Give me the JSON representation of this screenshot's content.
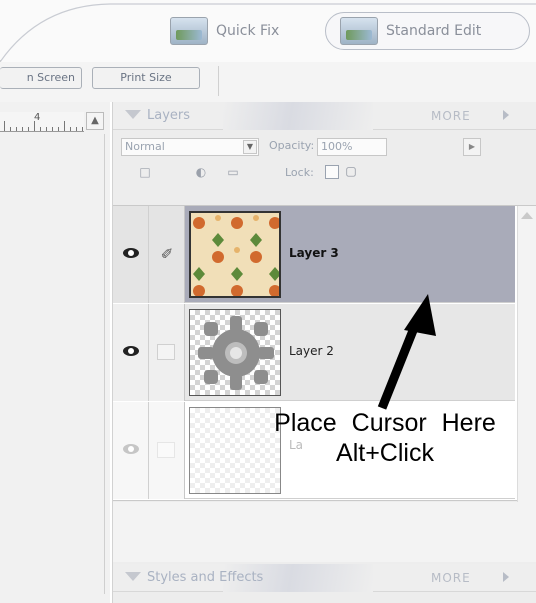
{
  "mode_bar": {
    "quick_fix_label": "Quick Fix",
    "standard_edit_label": "Standard Edit"
  },
  "zoom_bar": {
    "fit_screen_label": "n Screen",
    "print_size_label": "Print Size"
  },
  "ruler": {
    "number": "4"
  },
  "layers_panel": {
    "title": "Layers",
    "more_label": "MORE",
    "blend_mode": "Normal",
    "opacity_label": "Opacity:",
    "opacity_value": "100%",
    "lock_label": "Lock:",
    "layers": [
      {
        "name": "Layer 3",
        "selected": true,
        "visible": true
      },
      {
        "name": "Layer 2",
        "selected": false,
        "visible": true
      },
      {
        "name": "La",
        "selected": false,
        "visible": false
      }
    ]
  },
  "styles_panel": {
    "title": "Styles and Effects",
    "more_label": "MORE"
  },
  "annotation": {
    "line1": "Place Cursor Here",
    "line2": "Alt+Click"
  },
  "colors": {
    "selected_row": "#a9abb9",
    "header_text": "#a9b2c2"
  }
}
